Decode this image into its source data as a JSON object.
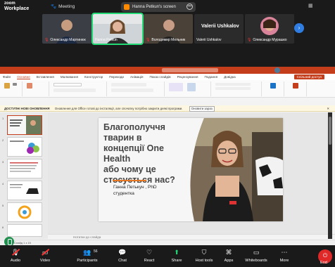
{
  "app": {
    "brand_top": "zoom",
    "brand_bottom": "Workplace",
    "meeting_label": "Meeting"
  },
  "share_banner": {
    "label": "Hanna Petkun's screen"
  },
  "participants": [
    {
      "name": "Олександр Мартинюк",
      "muted": true
    },
    {
      "name": "Hanna Petkun",
      "muted": false,
      "speaking": true
    },
    {
      "name": "Володимир Мельник",
      "muted": true
    },
    {
      "name": "Valerii Ushkalov",
      "muted": false,
      "big_label": "Valerii Ushkalov"
    },
    {
      "name": "Олександр Мурашко",
      "muted": true
    }
  ],
  "ppt": {
    "menus": [
      "Файл",
      "Основне",
      "Вставлення",
      "Малювання",
      "Конструктор",
      "Переходи",
      "Анімація",
      "Показ слайдів",
      "Рецензування",
      "Подання",
      "Довідка"
    ],
    "selected_menu": "Основне",
    "share_button": "Спільний доступ",
    "update_title": "ДОСТУПНІ НОВІ ОНОВЛЕННЯ",
    "update_text": "Оновлення для Office готові до інсталяції, але спочатку потрібно закрити деякі програми.",
    "update_button": "Оновити зараз",
    "notes_placeholder": "Нотатки до слайда",
    "status_text": "Слайд 1 з 15",
    "slide": {
      "title_lines": [
        "Благополуччя",
        "тварин в",
        "концепції One",
        "Health",
        "або чому це",
        "стосується нас?"
      ],
      "author_line1": "Ганна Петькун , PhD",
      "author_line2": "студентка"
    },
    "thumb_numbers": [
      "1",
      "2",
      "3",
      "4",
      "5",
      "6"
    ]
  },
  "toolbar": {
    "items": [
      {
        "label": "Audio",
        "icon": "microphone-muted-icon"
      },
      {
        "label": "Video",
        "icon": "camera-muted-icon"
      },
      {
        "label": "Participants",
        "icon": "participants-icon",
        "count": "56"
      },
      {
        "label": "Chat",
        "icon": "chat-icon"
      },
      {
        "label": "React",
        "icon": "heart-icon"
      },
      {
        "label": "Share",
        "icon": "share-icon"
      },
      {
        "label": "Host tools",
        "icon": "shield-icon"
      },
      {
        "label": "Apps",
        "icon": "apps-icon"
      },
      {
        "label": "Whiteboards",
        "icon": "whiteboard-icon"
      },
      {
        "label": "More",
        "icon": "more-icon"
      }
    ],
    "end_label": "End"
  },
  "colors": {
    "ppt_accent": "#c43e1c",
    "speaking": "#23d976",
    "end": "#e02828",
    "next": "#2f7de1"
  }
}
